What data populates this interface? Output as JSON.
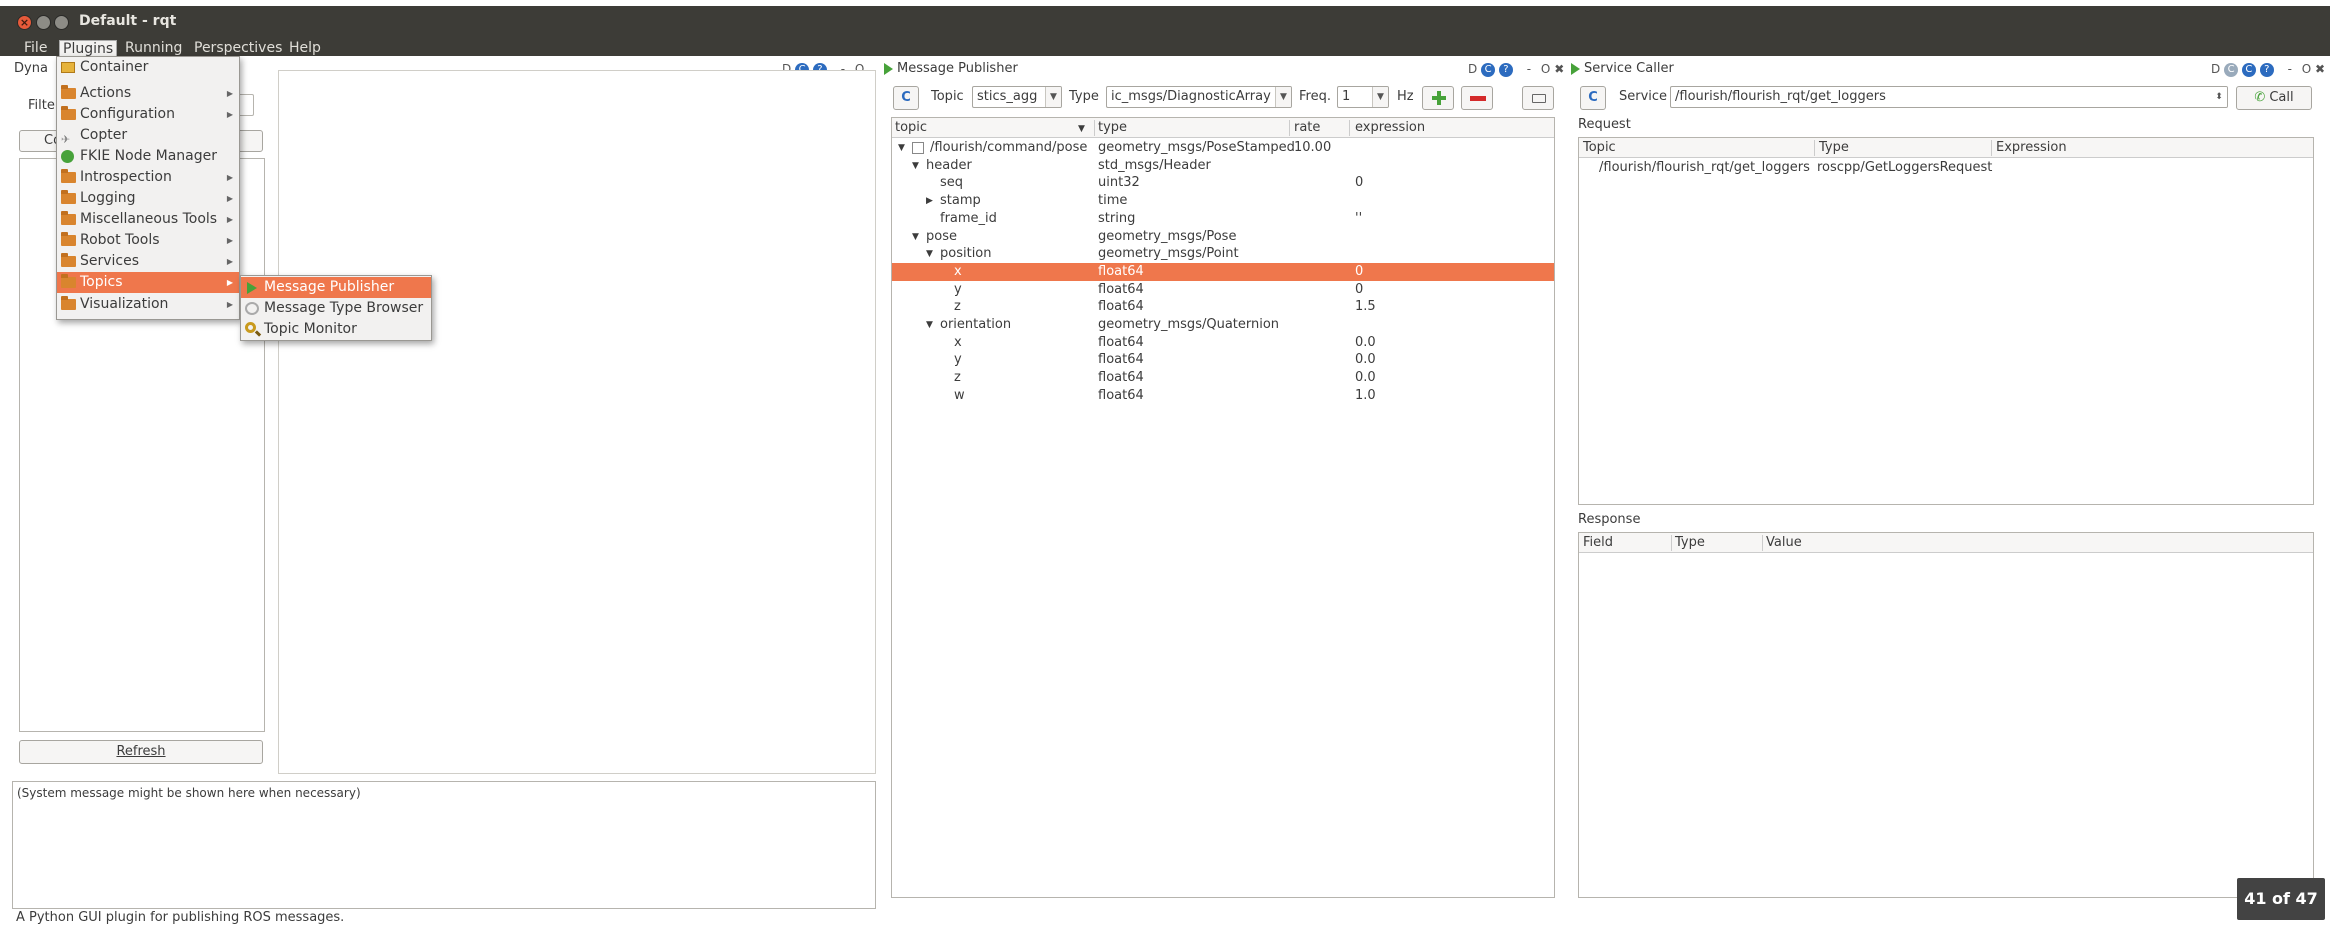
{
  "window": {
    "title": "Default - rqt",
    "close_glyph": "×"
  },
  "menubar": [
    {
      "label": "File"
    },
    {
      "label": "Plugins"
    },
    {
      "label": "Running"
    },
    {
      "label": "Perspectives"
    },
    {
      "label": "Help"
    }
  ],
  "left_panel": {
    "title_partial": "Dyna",
    "filter_label_partial": "Filte",
    "collapse_partial": "Co",
    "refresh_label": "Refresh",
    "system_message": "(System message might be shown here when necessary)"
  },
  "dock_controls": {
    "d": "D",
    "circle": "C",
    "help": "?",
    "dash": "-",
    "o": "O",
    "x": "✖"
  },
  "message_publisher": {
    "title": "Message Publisher",
    "topic_label": "Topic",
    "topic_value": "stics_agg",
    "type_label": "Type",
    "type_value": "ic_msgs/DiagnosticArray",
    "freq_label": "Freq.",
    "freq_value": "1",
    "hz_label": "Hz",
    "columns": [
      "topic",
      "type",
      "rate",
      "expression"
    ],
    "rows": [
      {
        "indent": 0,
        "expander": "▼",
        "checkbox": true,
        "topic": "/flourish/command/pose",
        "type": "geometry_msgs/PoseStamped",
        "rate": "10.00",
        "expression": ""
      },
      {
        "indent": 1,
        "expander": "▼",
        "topic": "header",
        "type": "std_msgs/Header",
        "rate": "",
        "expression": ""
      },
      {
        "indent": 2,
        "expander": "",
        "topic": "seq",
        "type": "uint32",
        "rate": "",
        "expression": "0"
      },
      {
        "indent": 2,
        "expander": "▶",
        "topic": "stamp",
        "type": "time",
        "rate": "",
        "expression": ""
      },
      {
        "indent": 2,
        "expander": "",
        "topic": "frame_id",
        "type": "string",
        "rate": "",
        "expression": "''"
      },
      {
        "indent": 1,
        "expander": "▼",
        "topic": "pose",
        "type": "geometry_msgs/Pose",
        "rate": "",
        "expression": ""
      },
      {
        "indent": 2,
        "expander": "▼",
        "topic": "position",
        "type": "geometry_msgs/Point",
        "rate": "",
        "expression": ""
      },
      {
        "indent": 3,
        "expander": "",
        "topic": "x",
        "type": "float64",
        "rate": "",
        "expression": "0",
        "selected": true
      },
      {
        "indent": 3,
        "expander": "",
        "topic": "y",
        "type": "float64",
        "rate": "",
        "expression": "0"
      },
      {
        "indent": 3,
        "expander": "",
        "topic": "z",
        "type": "float64",
        "rate": "",
        "expression": "1.5"
      },
      {
        "indent": 2,
        "expander": "▼",
        "topic": "orientation",
        "type": "geometry_msgs/Quaternion",
        "rate": "",
        "expression": ""
      },
      {
        "indent": 3,
        "expander": "",
        "topic": "x",
        "type": "float64",
        "rate": "",
        "expression": "0.0"
      },
      {
        "indent": 3,
        "expander": "",
        "topic": "y",
        "type": "float64",
        "rate": "",
        "expression": "0.0"
      },
      {
        "indent": 3,
        "expander": "",
        "topic": "z",
        "type": "float64",
        "rate": "",
        "expression": "0.0"
      },
      {
        "indent": 3,
        "expander": "",
        "topic": "w",
        "type": "float64",
        "rate": "",
        "expression": "1.0"
      }
    ]
  },
  "service_caller": {
    "title": "Service Caller",
    "service_label": "Service",
    "service_value": "/flourish/flourish_rqt/get_loggers",
    "call_label": "Call",
    "request_label": "Request",
    "request_columns": [
      "Topic",
      "Type",
      "Expression"
    ],
    "request_rows": [
      {
        "topic": "/flourish/flourish_rqt/get_loggers",
        "type": "roscpp/GetLoggersRequest",
        "expression": ""
      }
    ],
    "response_label": "Response",
    "response_columns": [
      "Field",
      "Type",
      "Value"
    ]
  },
  "plugins_menu": [
    {
      "label": "Container",
      "icon": "container-icon",
      "submenu": false
    },
    {
      "label": "Actions",
      "icon": "folder-icon",
      "submenu": true
    },
    {
      "label": "Configuration",
      "icon": "folder-icon",
      "submenu": true
    },
    {
      "label": "Copter",
      "icon": "copter-icon",
      "submenu": false
    },
    {
      "label": "FKIE Node Manager",
      "icon": "node-manager-icon",
      "submenu": false
    },
    {
      "label": "Introspection",
      "icon": "folder-icon",
      "submenu": true
    },
    {
      "label": "Logging",
      "icon": "folder-icon",
      "submenu": true
    },
    {
      "label": "Miscellaneous Tools",
      "icon": "folder-icon",
      "submenu": true
    },
    {
      "label": "Robot Tools",
      "icon": "folder-icon",
      "submenu": true
    },
    {
      "label": "Services",
      "icon": "folder-icon",
      "submenu": true
    },
    {
      "label": "Topics",
      "icon": "folder-icon",
      "submenu": true,
      "highlighted": true
    },
    {
      "label": "Visualization",
      "icon": "folder-icon",
      "submenu": true
    }
  ],
  "topics_submenu": [
    {
      "label": "Message Publisher",
      "icon": "play-icon",
      "highlighted": true
    },
    {
      "label": "Message Type Browser",
      "icon": "browser-icon"
    },
    {
      "label": "Topic Monitor",
      "icon": "magnifier-icon"
    }
  ],
  "status_bar": {
    "text": "A Python GUI plugin for publishing ROS messages."
  },
  "page_counter": "41 of 47"
}
